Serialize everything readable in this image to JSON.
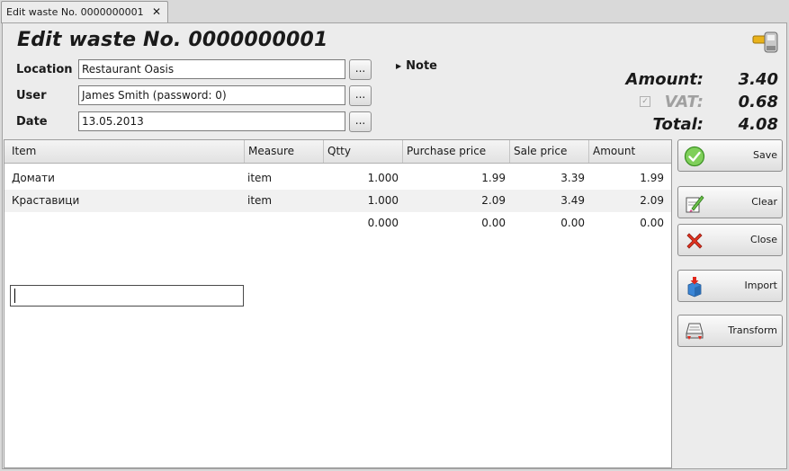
{
  "tab": {
    "label": "Edit waste No. 0000000001",
    "close_glyph": "✕"
  },
  "title": "Edit waste No. 0000000001",
  "form": {
    "location_label": "Location",
    "location_value": "Restaurant Oasis",
    "user_label": "User",
    "user_value": "James Smith (password: 0)",
    "date_label": "Date",
    "date_value": "13.05.2013",
    "browse_label": "..."
  },
  "note": {
    "label": "Note",
    "arrow": "▶"
  },
  "totals": {
    "amount_label": "Amount:",
    "amount_value": "3.40",
    "vat_label": "VAT:",
    "vat_value": "0.68",
    "vat_checked": true,
    "total_label": "Total:",
    "total_value": "4.08"
  },
  "grid": {
    "columns": [
      "Item",
      "Measure",
      "Qtty",
      "Purchase price",
      "Sale price",
      "Amount"
    ],
    "rows": [
      {
        "item": "Домати",
        "measure": "item",
        "qtty": "1.000",
        "purchase": "1.99",
        "sale": "3.39",
        "amount": "1.99"
      },
      {
        "item": "Краставици",
        "measure": "item",
        "qtty": "1.000",
        "purchase": "2.09",
        "sale": "3.49",
        "amount": "2.09"
      },
      {
        "item": "",
        "measure": "",
        "qtty": "0.000",
        "purchase": "0.00",
        "sale": "0.00",
        "amount": "0.00"
      }
    ]
  },
  "buttons": {
    "save": "Save",
    "clear": "Clear",
    "close": "Close",
    "import": "Import",
    "transform": "Transform"
  },
  "icons": {
    "header": "stamp-icon",
    "save": "check-circle-icon",
    "clear": "eraser-icon",
    "close": "red-x-icon",
    "import": "box-import-icon",
    "transform": "transform-icon"
  },
  "colors": {
    "accent_green": "#3fa32a",
    "close_red": "#d9241b",
    "import_blue": "#2f7fd3"
  }
}
